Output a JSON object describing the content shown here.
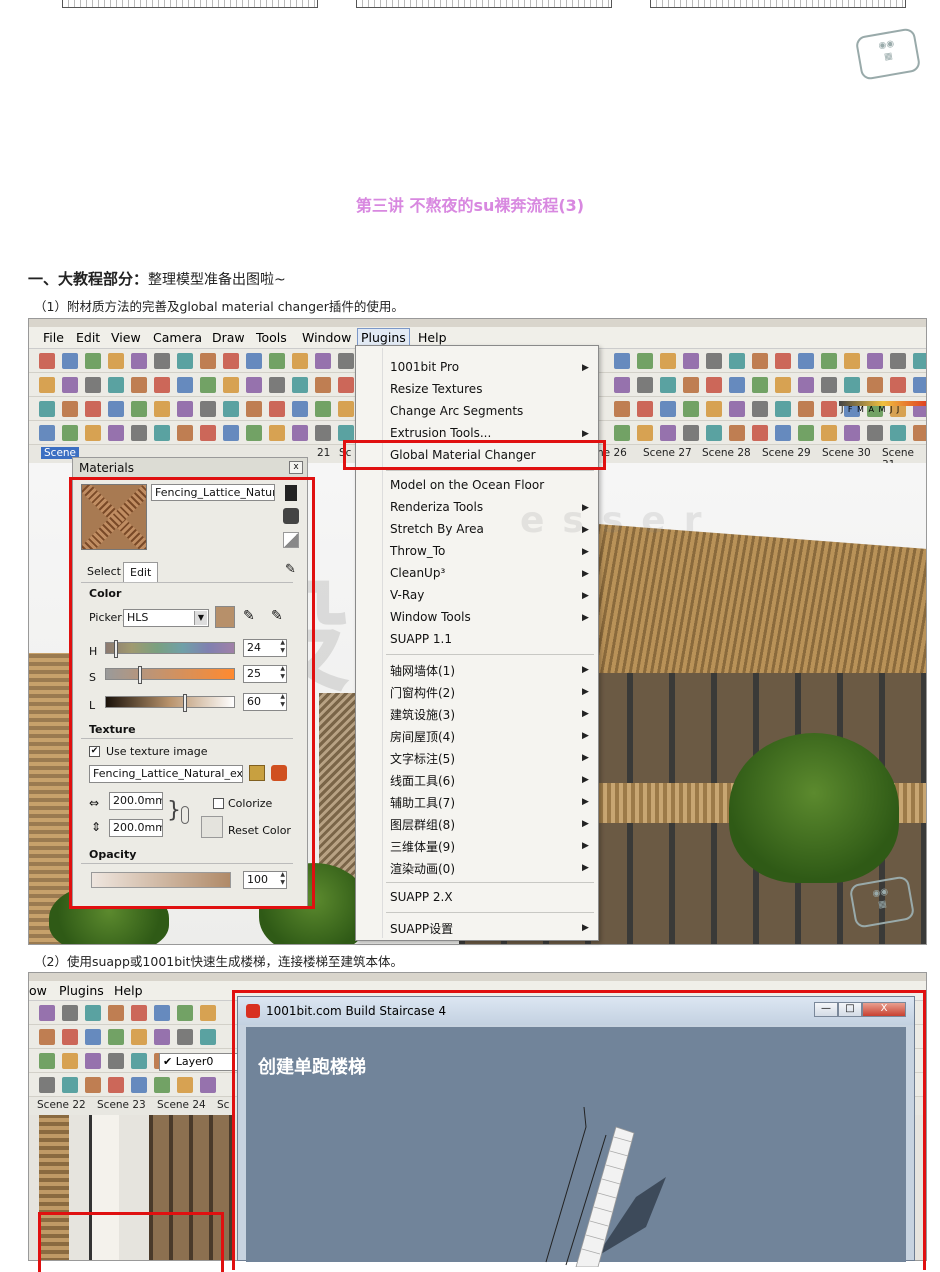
{
  "page": {
    "lecture_title": "第三讲 不熬夜的su裸奔流程(3)",
    "section_heading_strong": "一、大教程部分：",
    "section_heading_rest": "整理模型准备出图啦~",
    "step1": "（1）附材质方法的完善及global material changer插件的使用。",
    "step2": "（2）使用suapp或1001bit快速生成楼梯，连接楼梯至建筑本体。"
  },
  "screenshot1": {
    "menubar": [
      "File",
      "Edit",
      "View",
      "Camera",
      "Draw",
      "Tools",
      "Window",
      "Plugins",
      "Help"
    ],
    "active_menu": "Plugins",
    "scene_tabs": [
      "Scene",
      "21",
      "Sc",
      "ne 26",
      "Scene 27",
      "Scene 28",
      "Scene 29",
      "Scene 30",
      "Scene 31"
    ],
    "toolbar_text": "J F M A M J J"
  },
  "materials": {
    "title": "Materials",
    "close": "x",
    "material_name": "Fencing_Lattice_Natural",
    "tab_select": "Select",
    "tab_edit": "Edit",
    "color_heading": "Color",
    "picker_label": "Picker:",
    "picker_value": "HLS",
    "h_label": "H",
    "h_value": "24",
    "h_level": 0.08,
    "s_label": "S",
    "s_value": "25",
    "s_level": 0.25,
    "l_label": "L",
    "l_value": "60",
    "l_level": 0.6,
    "texture_heading": "Texture",
    "use_texture_label": "Use texture image",
    "use_texture_checked": "✔",
    "texture_file": "Fencing_Lattice_Natural_extrac",
    "width_value": "200.0mm",
    "height_value": "200.0mm",
    "colorize_label": "Colorize",
    "reset_color_label": "Reset Color",
    "opacity_heading": "Opacity",
    "opacity_value": "100"
  },
  "plugins_menu": {
    "items": [
      {
        "label": "1001bit Pro",
        "submenu": true
      },
      {
        "label": "Resize Textures",
        "submenu": false
      },
      {
        "label": "Change Arc Segments",
        "submenu": false
      },
      {
        "label": "Extrusion Tools...",
        "submenu": true
      },
      {
        "label": "Global Material Changer",
        "submenu": false
      },
      {
        "label": "Model on the Ocean Floor",
        "submenu": false
      },
      {
        "label": "Renderiza Tools",
        "submenu": true
      },
      {
        "label": "Stretch By Area",
        "submenu": true
      },
      {
        "label": "Throw_To",
        "submenu": true
      },
      {
        "label": "CleanUp³",
        "submenu": true
      },
      {
        "label": "V-Ray",
        "submenu": true
      },
      {
        "label": "Window Tools",
        "submenu": true
      },
      {
        "label": "SUAPP 1.1",
        "submenu": false
      },
      {
        "label": "轴网墙体(1)",
        "submenu": true
      },
      {
        "label": "门窗构件(2)",
        "submenu": true
      },
      {
        "label": "建筑设施(3)",
        "submenu": true
      },
      {
        "label": "房间屋顶(4)",
        "submenu": true
      },
      {
        "label": "文字标注(5)",
        "submenu": true
      },
      {
        "label": "线面工具(6)",
        "submenu": true
      },
      {
        "label": "辅助工具(7)",
        "submenu": true
      },
      {
        "label": "图层群组(8)",
        "submenu": true
      },
      {
        "label": "三维体量(9)",
        "submenu": true
      },
      {
        "label": "渲染动画(0)",
        "submenu": true
      },
      {
        "label": "SUAPP 2.X",
        "submenu": false
      },
      {
        "label": "SUAPP设置",
        "submenu": true
      }
    ],
    "arrow": "▶"
  },
  "screenshot2": {
    "menubar": [
      "ow",
      "Plugins",
      "Help"
    ],
    "layer_check": "✔",
    "layer_name": "Layer0",
    "scene_tabs": [
      "Scene 22",
      "Scene 23",
      "Scene 24",
      "Sc"
    ],
    "dialog_title": "1001bit.com Build Staircase 4",
    "dialog_heading": "创建单跑楼梯",
    "btn_minimize": "—",
    "btn_maximize": "□",
    "btn_close": "X"
  },
  "colors": {
    "title_pink": "#d888e0",
    "highlight_red": "#e01010"
  }
}
